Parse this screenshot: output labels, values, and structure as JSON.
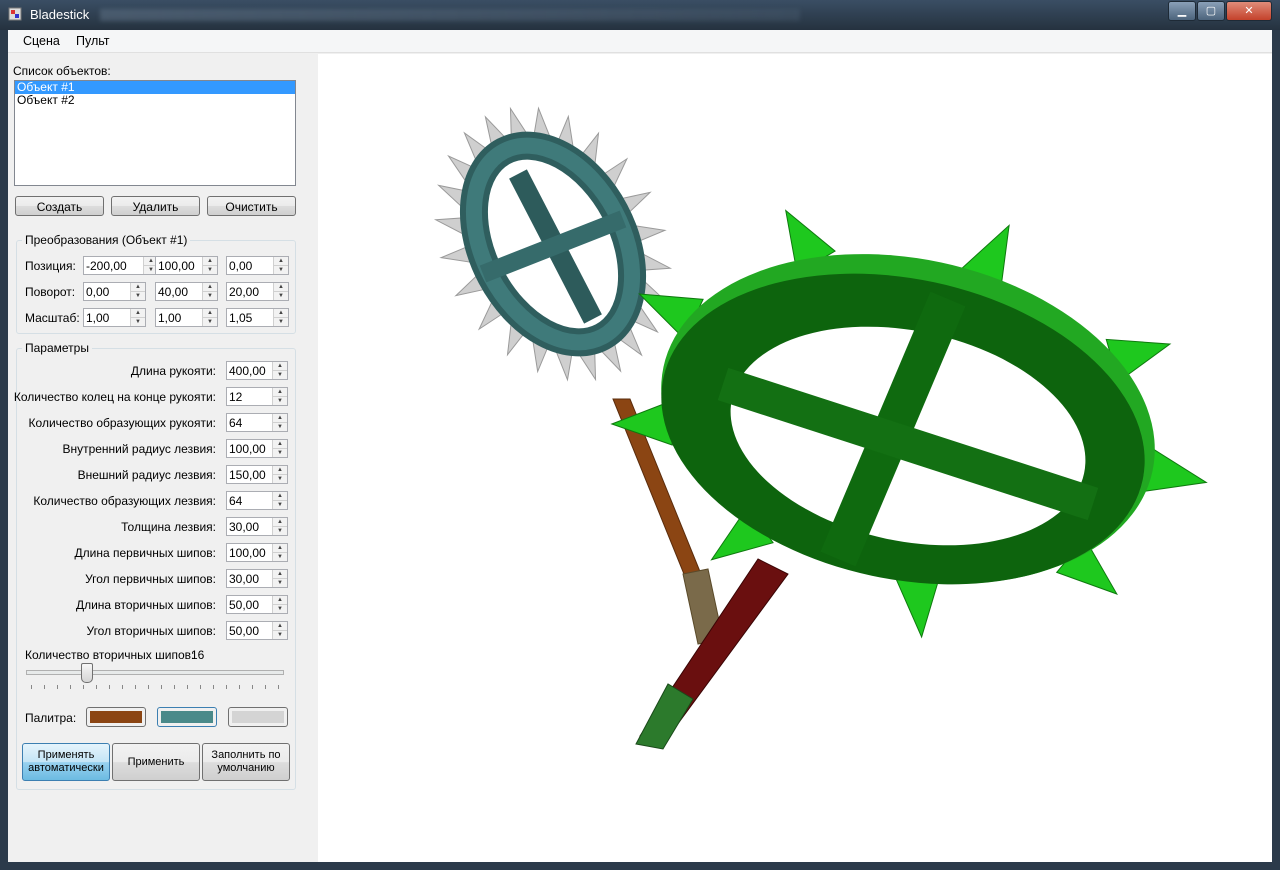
{
  "window": {
    "title": "Bladestick",
    "min_icon": "minimize-icon",
    "max_icon": "maximize-icon",
    "close_icon": "close-icon"
  },
  "menu": [
    "Сцена",
    "Пульт"
  ],
  "objects": {
    "label": "Список объектов:",
    "items": [
      "Объект #1",
      "Объект #2"
    ],
    "selected_index": 0,
    "buttons": {
      "create": "Создать",
      "delete": "Удалить",
      "clear": "Очистить"
    }
  },
  "transform": {
    "title": "Преобразования (Объект #1)",
    "position_label": "Позиция:",
    "position": [
      "-200,00",
      "100,00",
      "0,00"
    ],
    "rotation_label": "Поворот:",
    "rotation": [
      "0,00",
      "40,00",
      "20,00"
    ],
    "scale_label": "Масштаб:",
    "scale": [
      "1,00",
      "1,00",
      "1,05"
    ]
  },
  "params": {
    "title": "Параметры",
    "fields": [
      {
        "label": "Длина рукояти:",
        "value": "400,00"
      },
      {
        "label": "Количество колец на конце рукояти:",
        "value": "12"
      },
      {
        "label": "Количество образующих рукояти:",
        "value": "64"
      },
      {
        "label": "Внутренний радиус лезвия:",
        "value": "100,00"
      },
      {
        "label": "Внешний радиус лезвия:",
        "value": "150,00"
      },
      {
        "label": "Количество образующих лезвия:",
        "value": "64"
      },
      {
        "label": "Толщина лезвия:",
        "value": "30,00"
      },
      {
        "label": "Длина первичных шипов:",
        "value": "100,00"
      },
      {
        "label": "Угол первичных шипов:",
        "value": "30,00"
      },
      {
        "label": "Длина вторичных шипов:",
        "value": "50,00"
      },
      {
        "label": "Угол вторичных шипов:",
        "value": "50,00"
      }
    ],
    "secondary_count_label": "Количество вторичных шипов:",
    "secondary_count_value": "16",
    "palette_label": "Палитра:",
    "palette": [
      "#8b4513",
      "#4a8a8a",
      "#d4d4d4"
    ],
    "buttons": {
      "auto": "Применять автоматически",
      "apply": "Применить",
      "defaults": "Заполнить по умолчанию"
    }
  },
  "scene_colors": {
    "blade_green": "#12a012",
    "blade_teal": "#3a7070",
    "spikes_gray": "#c8c8c8",
    "handle_brown": "#8b4513",
    "handle_dark_red": "#6a0f0f"
  }
}
